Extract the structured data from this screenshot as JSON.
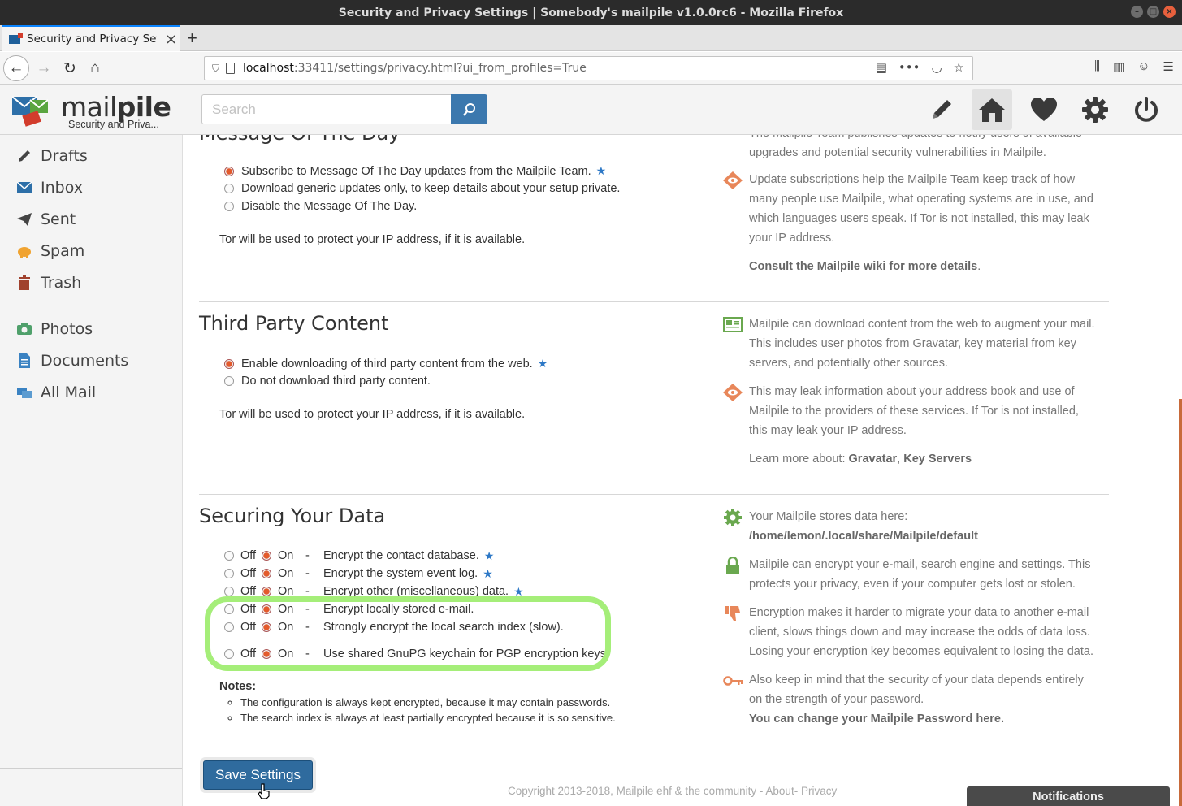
{
  "window": {
    "title": "Security and Privacy Settings | Somebody's mailpile v1.0.0rc6 - Mozilla Firefox"
  },
  "browser": {
    "tab_title": "Security and Privacy Sett",
    "tab_close": "×",
    "new_tab": "+",
    "url_host": "localhost",
    "url_rest": ":33411/settings/privacy.html?ui_from_profiles=True"
  },
  "header": {
    "logo_light": "mail",
    "logo_bold": "pile",
    "subtitle": "Security and Priva...",
    "search_placeholder": "Search"
  },
  "sidebar": {
    "items": [
      {
        "label": "Drafts",
        "icon": "pencil-icon"
      },
      {
        "label": "Inbox",
        "icon": "envelope-icon"
      },
      {
        "label": "Sent",
        "icon": "paper-plane-icon"
      },
      {
        "label": "Spam",
        "icon": "pig-icon"
      },
      {
        "label": "Trash",
        "icon": "trash-icon"
      },
      {
        "label": "Photos",
        "icon": "camera-icon"
      },
      {
        "label": "Documents",
        "icon": "document-icon"
      },
      {
        "label": "All Mail",
        "icon": "letters-icon"
      }
    ]
  },
  "motd": {
    "title": "Message Of The Day",
    "options": [
      "Subscribe to Message Of The Day updates from the Mailpile Team.",
      "Download generic updates only, to keep details about your setup private.",
      "Disable the Message Of The Day."
    ],
    "tor_note": "Tor will be used to protect your IP address, if it is available.",
    "info_top": "The Mailpile Team publishes updates to notify users of available upgrades and potential security vulnerabilities in Mailpile.",
    "info_tracking": "Update subscriptions help the Mailpile Team keep track of how many people use Mailpile, what operating systems are in use, and which languages users speak. If Tor is not installed, this may leak your IP address.",
    "info_link": "Consult the Mailpile wiki for more details"
  },
  "third_party": {
    "title": "Third Party Content",
    "options": [
      "Enable downloading of third party content from the web.",
      "Do not download third party content."
    ],
    "tor_note": "Tor will be used to protect your IP address, if it is available.",
    "info_download": "Mailpile can download content from the web to augment your mail. This includes user photos from Gravatar, key material from key servers, and potentially other sources.",
    "info_leak": "This may leak information about your address book and use of Mailpile to the providers of these services. If Tor is not installed, this may leak your IP address.",
    "learn_more": "Learn more about:",
    "link_gravatar": "Gravatar",
    "link_keyservers": "Key Servers"
  },
  "securing": {
    "title": "Securing Your Data",
    "off_label": "Off",
    "on_label": "On",
    "dash": "-",
    "rows": [
      "Encrypt the contact database.",
      "Encrypt the system event log.",
      "Encrypt other (miscellaneous) data.",
      "Encrypt locally stored e-mail.",
      "Strongly encrypt the local search index (slow).",
      "Use shared GnuPG keychain for PGP encryption keys."
    ],
    "notes_title": "Notes:",
    "notes": [
      "The configuration is always kept encrypted, because it may contain passwords.",
      "The search index is always at least partially encrypted because it is so sensitive."
    ],
    "info_stores": "Your Mailpile stores data here:",
    "info_path": "/home/lemon/.local/share/Mailpile/default",
    "info_encrypt": "Mailpile can encrypt your e-mail, search engine and settings. This protects your privacy, even if your computer gets lost or stolen.",
    "info_migrate": "Encryption makes it harder to migrate your data to another e-mail client, slows things down and may increase the odds of data loss. Losing your encryption key becomes equivalent to losing the data.",
    "info_password": "Also keep in mind that the security of your data depends entirely on the strength of your password.",
    "info_password_link": "You can change your Mailpile Password here."
  },
  "footer": {
    "save_label": "Save Settings",
    "copyright": "Copyright 2013-2018, Mailpile ehf & the community - About- Privacy",
    "notifications": "Notifications"
  },
  "colors": {
    "accent_blue": "#3b78ae",
    "radio_on": "#e35a2c",
    "highlight_green": "#a5ee79",
    "info_orange": "#e8875a",
    "info_green": "#6aa84f"
  }
}
